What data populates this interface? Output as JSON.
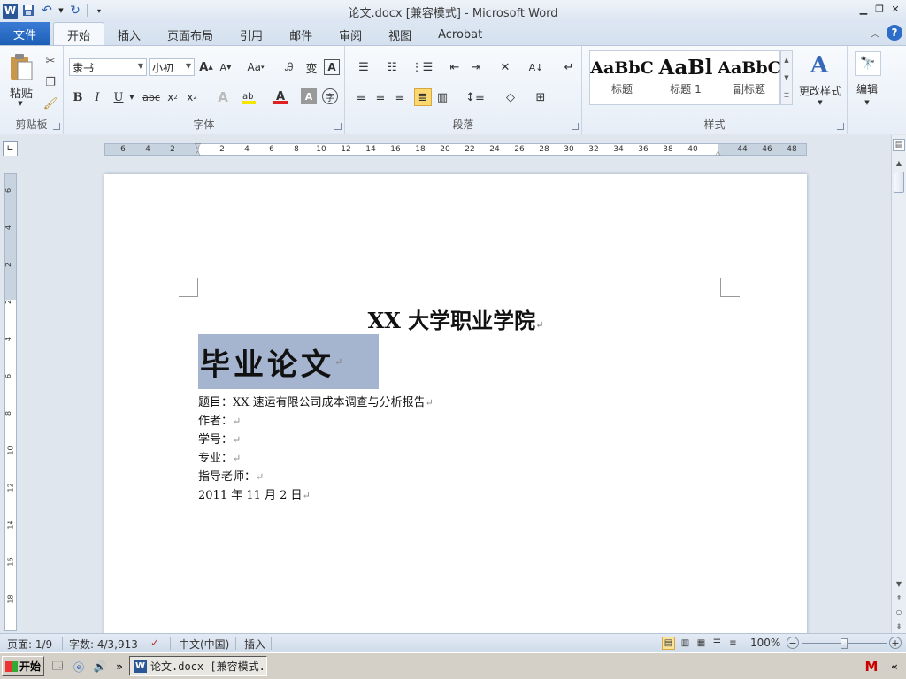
{
  "window": {
    "title": "论文.docx [兼容模式] - Microsoft Word",
    "app_icon_letter": "W"
  },
  "tabs": {
    "file": "文件",
    "items": [
      "开始",
      "插入",
      "页面布局",
      "引用",
      "邮件",
      "审阅",
      "视图",
      "Acrobat"
    ],
    "active_index": 0
  },
  "ribbon": {
    "clipboard": {
      "paste_label": "粘贴",
      "group_label": "剪贴板"
    },
    "font": {
      "font_name": "隶书",
      "font_size": "小初",
      "group_label": "字体",
      "grow": "A",
      "shrink": "A",
      "change_case": "Aa",
      "bold": "B",
      "italic": "I",
      "underline": "U",
      "strike": "abc",
      "subscript": "x",
      "superscript": "x",
      "highlight_color": "#f5e600",
      "font_color": "#e02020"
    },
    "paragraph": {
      "group_label": "段落"
    },
    "styles": {
      "group_label": "样式",
      "items": [
        {
          "sample": "AaBbC",
          "name": "标题"
        },
        {
          "sample": "AaBl",
          "name": "标题 1"
        },
        {
          "sample": "AaBbC",
          "name": "副标题"
        }
      ],
      "change_styles": "更改样式"
    },
    "editing": {
      "label": "编辑"
    }
  },
  "ruler": {
    "ticks": [
      "6",
      "4",
      "2",
      "2",
      "4",
      "6",
      "8",
      "10",
      "12",
      "14",
      "16",
      "18",
      "20",
      "22",
      "24",
      "26",
      "28",
      "30",
      "32",
      "34",
      "36",
      "38",
      "40",
      "44",
      "46",
      "48"
    ],
    "vticks": [
      "6",
      "4",
      "2",
      "2",
      "4",
      "6",
      "8",
      "10",
      "12",
      "14",
      "16",
      "18"
    ]
  },
  "document": {
    "university": "XX 大学职业学院",
    "thesis_title": "毕业论文",
    "para_mark": "↵",
    "lines": [
      "题目：XX 速运有限公司成本调查与分析报告",
      "作者：",
      "学号：",
      "专业：",
      "指导老师：",
      "2011 年 11 月 2 日"
    ],
    "selection_color": "#a5b4cf"
  },
  "status": {
    "page": "页面: 1/9",
    "words": "字数: 4/3,913",
    "language": "中文(中国)",
    "mode": "插入",
    "zoom": "100%"
  },
  "taskbar": {
    "start": "开始",
    "task_label": "论文.docx [兼容模式...",
    "more": "»",
    "tray_more": "«"
  }
}
